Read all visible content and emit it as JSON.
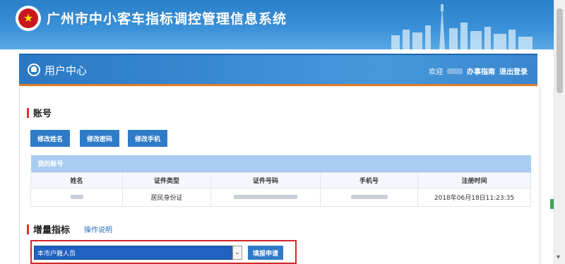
{
  "header": {
    "system_title": "广州市中小客车指标调控管理信息系统",
    "logo": "emblem-logo"
  },
  "user_bar": {
    "title": "用户中心",
    "welcome": "欢迎",
    "guide_link": "办事指南",
    "logout_link": "退出登录"
  },
  "account_section": {
    "title": "账号",
    "buttons": [
      "修改姓名",
      "修改密码",
      "修改手机"
    ],
    "table_caption": "我的账号",
    "columns": [
      "姓名",
      "证件类型",
      "证件号码",
      "手机号",
      "注册时间"
    ],
    "row": {
      "id_type": "居民身份证",
      "register_time": "2018年06月18日11:23:35"
    }
  },
  "quota_section": {
    "title": "增量指标",
    "help_link": "操作说明",
    "select_value": "本市户籍人员",
    "apply_button": "填报申请"
  },
  "colors": {
    "banner_blue": "#2a7fc9",
    "accent_red": "#e0312b",
    "button_blue": "#2f7bc8",
    "table_caption": "#a9ccf0"
  }
}
